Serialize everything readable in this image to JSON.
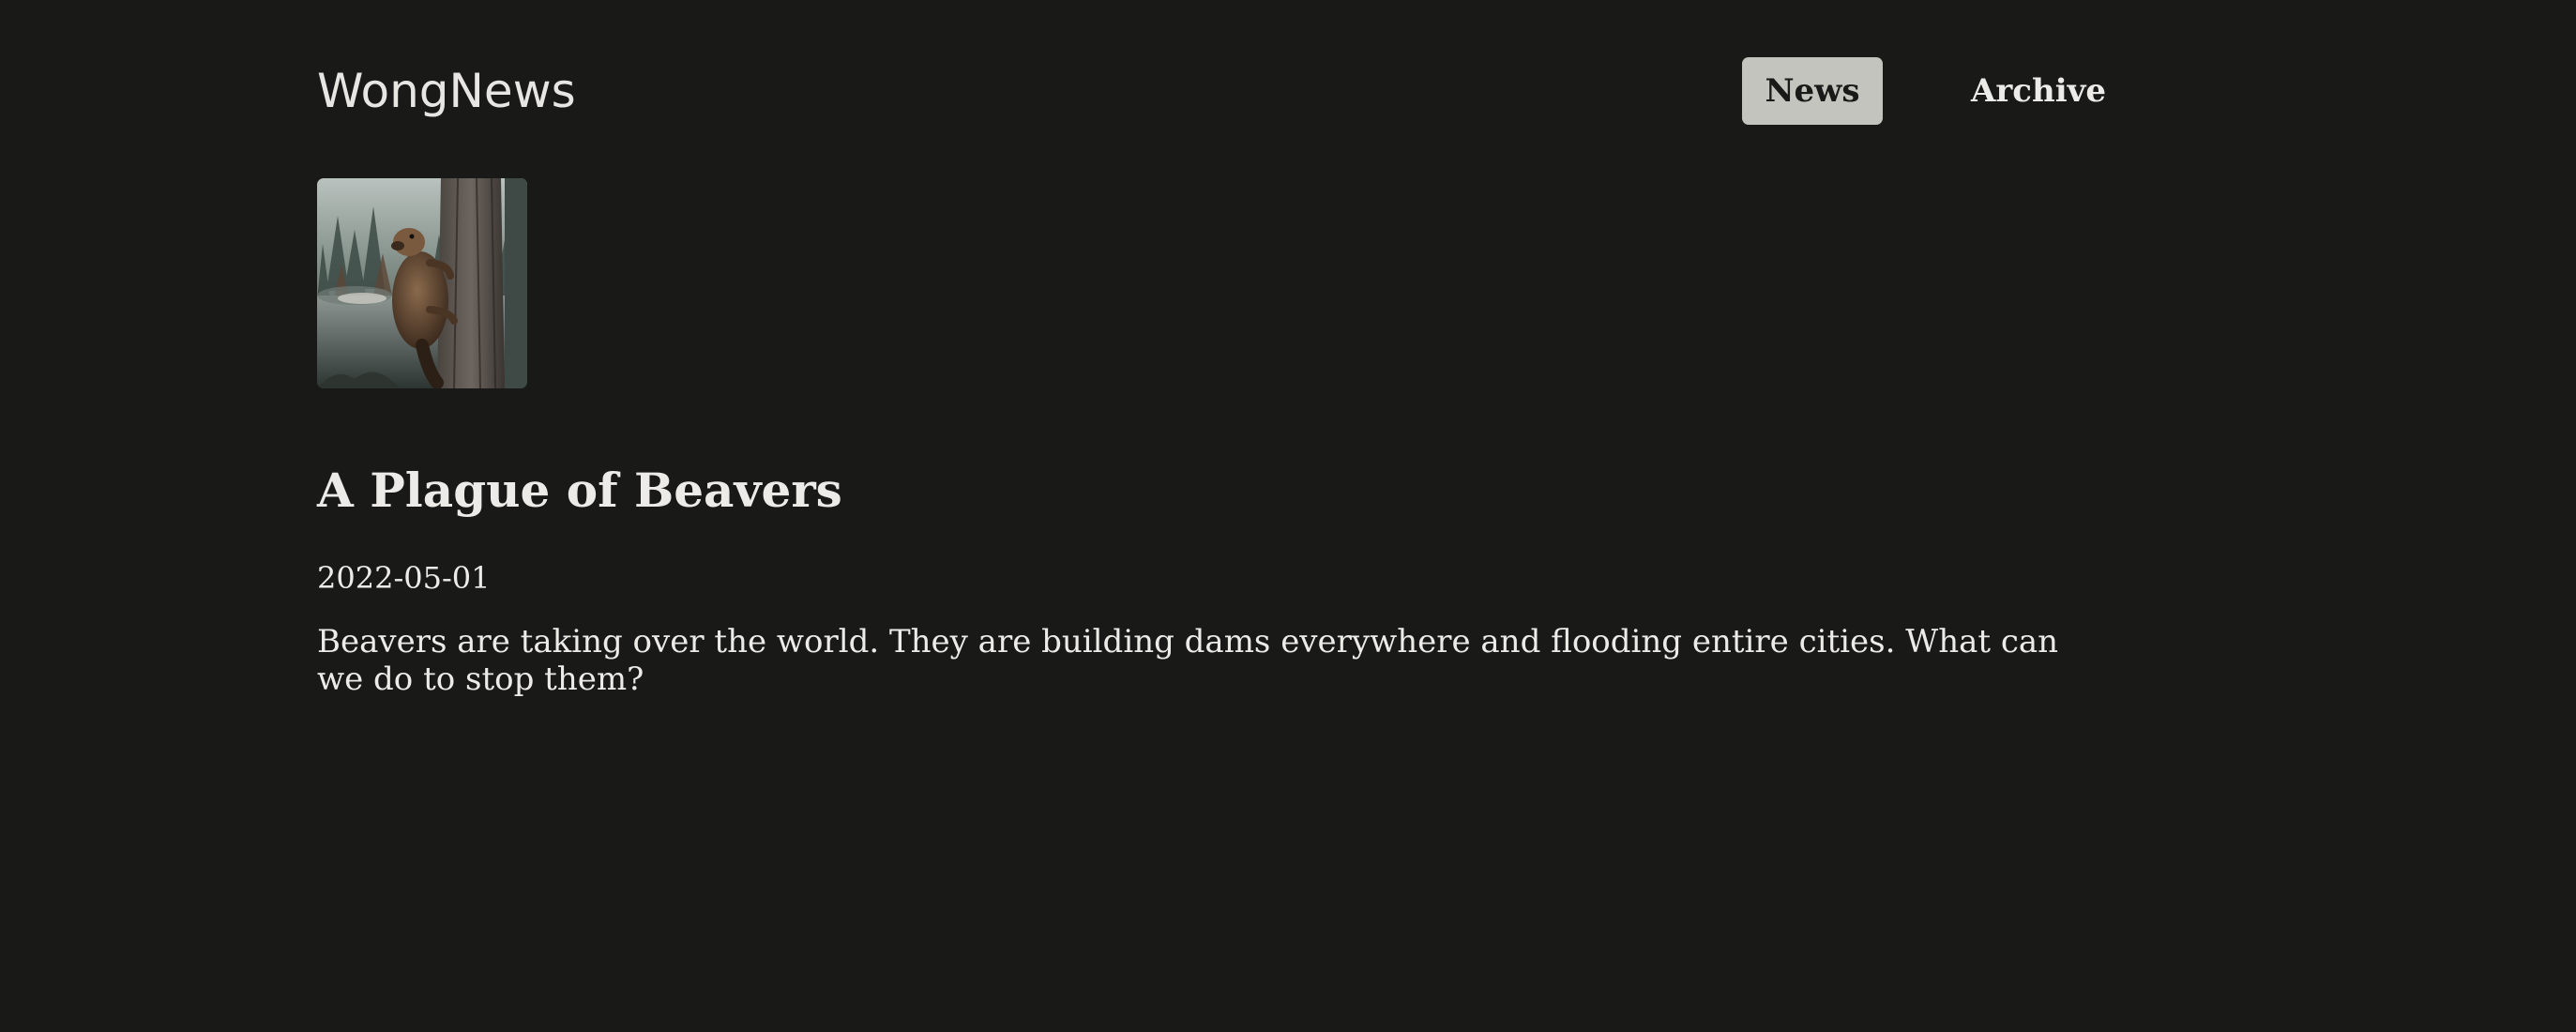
{
  "site": {
    "title": "WongNews"
  },
  "nav": {
    "items": [
      {
        "label": "News",
        "active": true
      },
      {
        "label": "Archive",
        "active": false
      }
    ]
  },
  "post": {
    "title": "A Plague of Beavers",
    "date": "2022-05-01",
    "body": "Beavers are taking over the world. They are building dams everywhere and flooding entire cities. What can we do to stop them?"
  },
  "colors": {
    "background": "#191917",
    "text": "#e7e6e2",
    "nav_active_bg": "#c3c4be"
  }
}
